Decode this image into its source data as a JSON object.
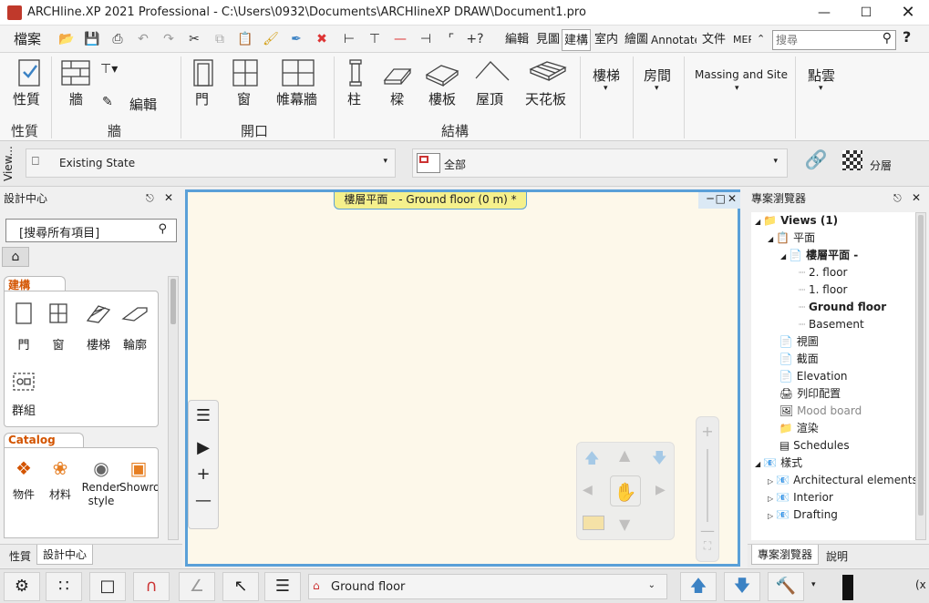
{
  "window": {
    "title": "ARCHline.XP 2021  Professional - C:\\Users\\0932\\Documents\\ARCHlineXP DRAW\\Document1.pro"
  },
  "quick_toolbar": {
    "file_label": "檔案",
    "tabs": [
      "編輯",
      "見圖",
      "建構",
      "室内",
      "繪圖",
      "Annotate",
      "文件",
      "MEP"
    ],
    "search_placeholder": "搜尋",
    "help": "?"
  },
  "ribbon": {
    "properties": {
      "label": "性質",
      "group": "性質"
    },
    "wall": {
      "wall_label": "牆",
      "edit_label": "編輯",
      "group": "牆"
    },
    "openings": {
      "door": "門",
      "window": "窗",
      "curtain": "帷幕牆",
      "group": "開口"
    },
    "structure": {
      "column": "柱",
      "beam": "樑",
      "slab": "樓板",
      "roof": "屋頂",
      "ceiling": "天花板",
      "group": "結構"
    },
    "extra": [
      "樓梯",
      "房間",
      "Massing and Site",
      "點雲"
    ]
  },
  "viewrow": {
    "view_tab": "View...",
    "state": "Existing State",
    "layer": "全部",
    "layers_label": "分層"
  },
  "design_center": {
    "title": "設計中心",
    "search": "[搜尋所有項目]",
    "building_header": "建構",
    "building_items": [
      "門",
      "窗",
      "樓梯",
      "輪廓",
      "群組"
    ],
    "catalog_header": "Catalog",
    "catalog_items": [
      "物件",
      "材料",
      "Render style",
      "Showroom"
    ],
    "bottom_tabs": [
      "性質",
      "設計中心"
    ]
  },
  "canvas": {
    "tab_title": "樓層平面 -  - Ground floor (0 m) *"
  },
  "project_browser": {
    "title": "專案瀏覽器",
    "tree": [
      {
        "label": "Views (1)",
        "level": 0,
        "bold": true
      },
      {
        "label": "平面",
        "level": 1
      },
      {
        "label": "樓層平面 -",
        "level": 2,
        "bold": true
      },
      {
        "label": "2. floor",
        "level": 3
      },
      {
        "label": "1. floor",
        "level": 3
      },
      {
        "label": "Ground floor",
        "level": 3,
        "bold": true
      },
      {
        "label": "Basement",
        "level": 3
      },
      {
        "label": "視圖",
        "level": 1
      },
      {
        "label": "截面",
        "level": 1
      },
      {
        "label": "Elevation",
        "level": 1
      },
      {
        "label": "列印配置",
        "level": 1
      },
      {
        "label": "Mood board",
        "level": 1
      },
      {
        "label": "渲染",
        "level": 1
      },
      {
        "label": "Schedules",
        "level": 1
      },
      {
        "label": "樣式",
        "level": 0
      },
      {
        "label": "Architectural elements",
        "level": 1
      },
      {
        "label": "Interior",
        "level": 1
      },
      {
        "label": "Drafting",
        "level": 1
      }
    ],
    "bottom_tabs": [
      "專案瀏覽器",
      "說明"
    ]
  },
  "statusbar": {
    "floor": "Ground floor"
  }
}
